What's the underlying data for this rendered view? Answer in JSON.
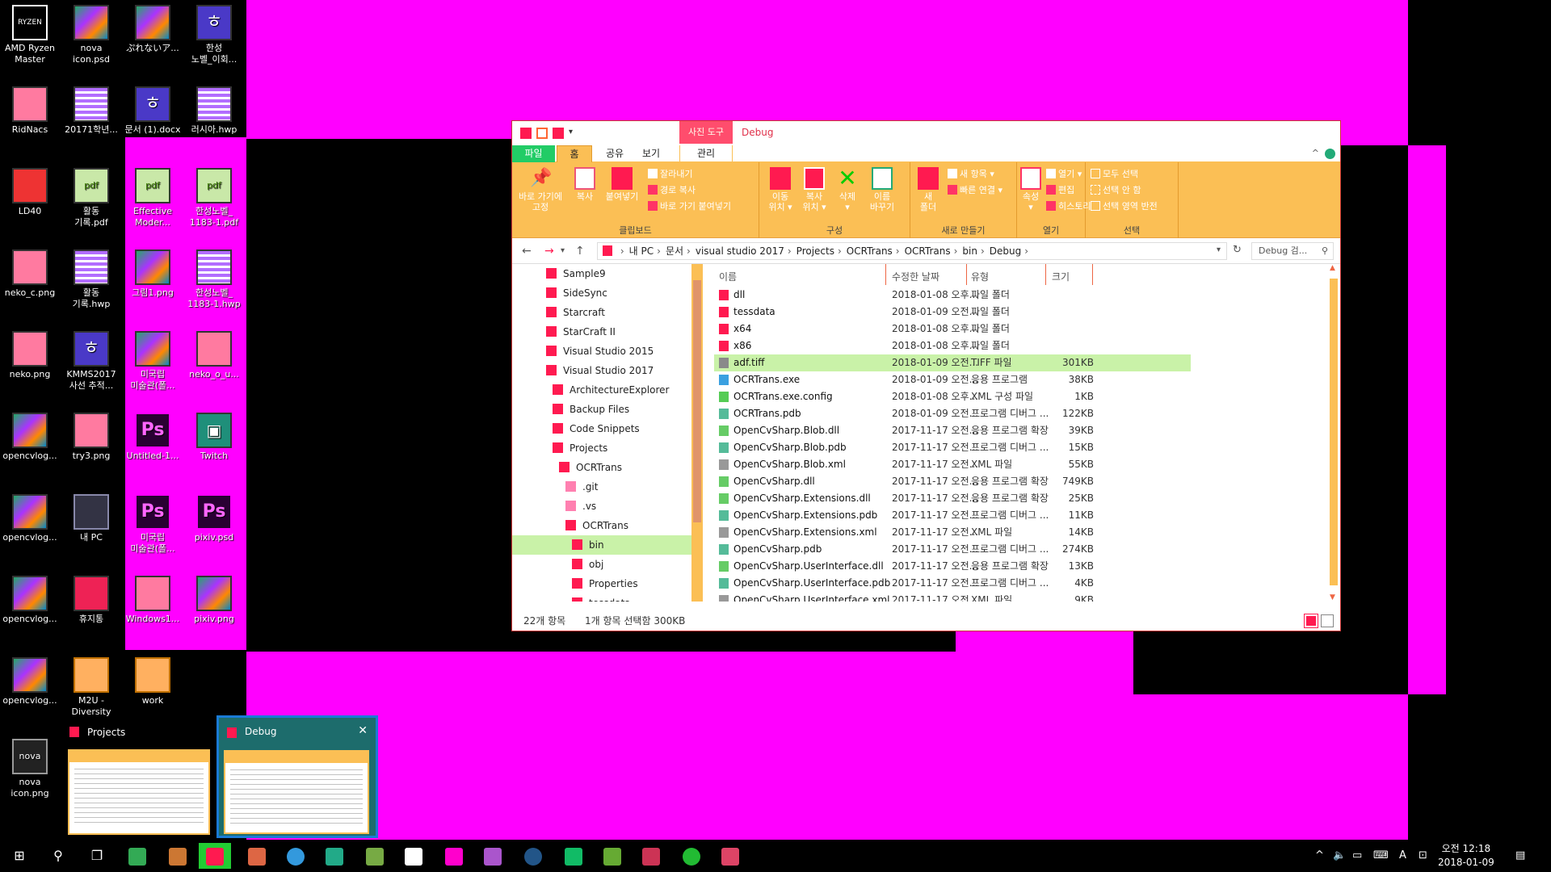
{
  "desktop": {
    "icons": [
      {
        "label": "AMD Ryzen\nMaster",
        "kind": "ryzen"
      },
      {
        "label": "nova\nicon.psd",
        "kind": "pic"
      },
      {
        "label": "ぷれないア...",
        "kind": "pic"
      },
      {
        "label": "한성\n노벨_이회...",
        "kind": "hw"
      },
      {
        "label": "RidNacs",
        "kind": "pink"
      },
      {
        "label": "20171학년...",
        "kind": "note"
      },
      {
        "label": "문서 (1).docx",
        "kind": "hw"
      },
      {
        "label": "러시아.hwp",
        "kind": "note"
      },
      {
        "label": "LD40",
        "kind": "red"
      },
      {
        "label": "활동\n기록.pdf",
        "kind": "pdf"
      },
      {
        "label": "Effective\nModer...",
        "kind": "pdf"
      },
      {
        "label": "한성노벨_\n1183-1.pdf",
        "kind": "pdf"
      },
      {
        "label": "neko_c.png",
        "kind": "pink"
      },
      {
        "label": "활동\n기록.hwp",
        "kind": "note"
      },
      {
        "label": "그림1.png",
        "kind": "pic"
      },
      {
        "label": "한성노벨_\n1183-1.hwp",
        "kind": "note"
      },
      {
        "label": "neko.png",
        "kind": "pink"
      },
      {
        "label": "KMMS2017\n사선 추적...",
        "kind": "hw"
      },
      {
        "label": "미국립\n미술관(폴...",
        "kind": "pic"
      },
      {
        "label": "neko_o_u...",
        "kind": "pink"
      },
      {
        "label": "opencvlog...",
        "kind": "pic"
      },
      {
        "label": "try3.png",
        "kind": "pink"
      },
      {
        "label": "Untitled-1...",
        "kind": "ps"
      },
      {
        "label": "Twitch",
        "kind": "tw"
      },
      {
        "label": "opencvlog...",
        "kind": "pic"
      },
      {
        "label": "내 PC",
        "kind": "pc"
      },
      {
        "label": "미국립\n미술관(폴...",
        "kind": "ps"
      },
      {
        "label": "pixiv.psd",
        "kind": "ps"
      },
      {
        "label": "opencvlog...",
        "kind": "pic"
      },
      {
        "label": "휴지통",
        "kind": "bin"
      },
      {
        "label": "Windows1...",
        "kind": "pink"
      },
      {
        "label": "pixiv.png",
        "kind": "pic"
      },
      {
        "label": "opencvlog...",
        "kind": "pic"
      },
      {
        "label": "M2U -\nDiversity",
        "kind": "folder"
      },
      {
        "label": "work",
        "kind": "folder"
      },
      {
        "label": "",
        "kind": "none"
      },
      {
        "label": "nova\nicon.png",
        "kind": "nova"
      }
    ]
  },
  "explorer": {
    "title": "Debug",
    "picture_tools": "사진 도구",
    "tabs": [
      "파일",
      "홈",
      "공유",
      "보기",
      "관리"
    ],
    "ribbon": {
      "pin": "바로 가기에\n고정",
      "copy": "복사",
      "paste": "붙여넣기",
      "cut": "잘라내기",
      "copy_path": "경로 복사",
      "paste_shortcut": "바로 가기 붙여넣기",
      "clipboard": "클립보드",
      "move_to": "이동\n위치 ▾",
      "copy_to": "복사\n위치 ▾",
      "delete": "삭제\n▾",
      "rename": "이름\n바꾸기",
      "organize": "구성",
      "new_folder": "새\n폴더",
      "new_item": "새 항목 ▾",
      "easy_access": "빠른 연결 ▾",
      "new": "새로 만들기",
      "properties": "속성\n▾",
      "open": "열기 ▾",
      "edit": "편집",
      "history": "히스토리",
      "open_group": "열기",
      "select_all": "모두 선택",
      "select_none": "선택 안 함",
      "invert": "선택 영역 반전",
      "select": "선택"
    },
    "breadcrumb": [
      "내 PC",
      "문서",
      "visual studio 2017",
      "Projects",
      "OCRTrans",
      "OCRTrans",
      "bin",
      "Debug"
    ],
    "search_placeholder": "Debug 검...",
    "nav_items": [
      {
        "label": "Sample9",
        "indent": 0
      },
      {
        "label": "SideSync",
        "indent": 0
      },
      {
        "label": "Starcraft",
        "indent": 0
      },
      {
        "label": "StarCraft II",
        "indent": 0
      },
      {
        "label": "Visual Studio 2015",
        "indent": 0
      },
      {
        "label": "Visual Studio 2017",
        "indent": 0
      },
      {
        "label": "ArchitectureExplorer",
        "indent": 1
      },
      {
        "label": "Backup Files",
        "indent": 1
      },
      {
        "label": "Code Snippets",
        "indent": 1
      },
      {
        "label": "Projects",
        "indent": 1
      },
      {
        "label": "OCRTrans",
        "indent": 2
      },
      {
        "label": ".git",
        "indent": 3
      },
      {
        "label": ".vs",
        "indent": 3
      },
      {
        "label": "OCRTrans",
        "indent": 3
      },
      {
        "label": "bin",
        "indent": 4
      },
      {
        "label": "obj",
        "indent": 4
      },
      {
        "label": "Properties",
        "indent": 4
      },
      {
        "label": "tessdata",
        "indent": 4
      }
    ],
    "columns": {
      "name": "이름",
      "date": "수정한 날짜",
      "type": "유형",
      "size": "크기"
    },
    "files": [
      {
        "name": "dll",
        "date": "2018-01-08 오후...",
        "type": "파일 폴더",
        "size": "",
        "icon": "folder"
      },
      {
        "name": "tessdata",
        "date": "2018-01-09 오전...",
        "type": "파일 폴더",
        "size": "",
        "icon": "folder"
      },
      {
        "name": "x64",
        "date": "2018-01-08 오후...",
        "type": "파일 폴더",
        "size": "",
        "icon": "folder"
      },
      {
        "name": "x86",
        "date": "2018-01-08 오후...",
        "type": "파일 폴더",
        "size": "",
        "icon": "folder"
      },
      {
        "name": "adf.tiff",
        "date": "2018-01-09 오전...",
        "type": "TIFF 파일",
        "size": "301KB",
        "icon": "img"
      },
      {
        "name": "OCRTrans.exe",
        "date": "2018-01-09 오전...",
        "type": "응용 프로그램",
        "size": "38KB",
        "icon": "exe"
      },
      {
        "name": "OCRTrans.exe.config",
        "date": "2018-01-08 오후...",
        "type": "XML 구성 파일",
        "size": "1KB",
        "icon": "cfg"
      },
      {
        "name": "OCRTrans.pdb",
        "date": "2018-01-09 오전...",
        "type": "프로그램 디버그 ...",
        "size": "122KB",
        "icon": "pdb"
      },
      {
        "name": "OpenCvSharp.Blob.dll",
        "date": "2017-11-17 오전...",
        "type": "응용 프로그램 확장",
        "size": "39KB",
        "icon": "dll"
      },
      {
        "name": "OpenCvSharp.Blob.pdb",
        "date": "2017-11-17 오전...",
        "type": "프로그램 디버그 ...",
        "size": "15KB",
        "icon": "pdb"
      },
      {
        "name": "OpenCvSharp.Blob.xml",
        "date": "2017-11-17 오전...",
        "type": "XML 파일",
        "size": "55KB",
        "icon": "xml"
      },
      {
        "name": "OpenCvSharp.dll",
        "date": "2017-11-17 오전...",
        "type": "응용 프로그램 확장",
        "size": "749KB",
        "icon": "dll"
      },
      {
        "name": "OpenCvSharp.Extensions.dll",
        "date": "2017-11-17 오전...",
        "type": "응용 프로그램 확장",
        "size": "25KB",
        "icon": "dll"
      },
      {
        "name": "OpenCvSharp.Extensions.pdb",
        "date": "2017-11-17 오전...",
        "type": "프로그램 디버그 ...",
        "size": "11KB",
        "icon": "pdb"
      },
      {
        "name": "OpenCvSharp.Extensions.xml",
        "date": "2017-11-17 오전...",
        "type": "XML 파일",
        "size": "14KB",
        "icon": "xml"
      },
      {
        "name": "OpenCvSharp.pdb",
        "date": "2017-11-17 오전...",
        "type": "프로그램 디버그 ...",
        "size": "274KB",
        "icon": "pdb"
      },
      {
        "name": "OpenCvSharp.UserInterface.dll",
        "date": "2017-11-17 오전...",
        "type": "응용 프로그램 확장",
        "size": "13KB",
        "icon": "dll"
      },
      {
        "name": "OpenCvSharp.UserInterface.pdb",
        "date": "2017-11-17 오전...",
        "type": "프로그램 디버그 ...",
        "size": "4KB",
        "icon": "pdb"
      },
      {
        "name": "OpenCvSharp.UserInterface.xml",
        "date": "2017-11-17 오전...",
        "type": "XML 파일",
        "size": "9KB",
        "icon": "xml"
      }
    ],
    "selected_index": 4,
    "status_count": "22개 항목",
    "status_selected": "1개 항목 선택함 300KB"
  },
  "thumbnails": {
    "projects_title": "Projects",
    "debug_title": "Debug",
    "close": "✕"
  },
  "taskbar": {
    "start": "⊞",
    "search": "⚲",
    "taskview": "❐",
    "tray_chevron": "^",
    "ime": "A",
    "time": "오전 12:18",
    "date": "2018-01-09"
  },
  "colors": {
    "desktop_magenta": "#ff00ff",
    "ribbon": "#fbbf55",
    "selection": "#c9f2a8",
    "folder": "#ff1a50"
  }
}
